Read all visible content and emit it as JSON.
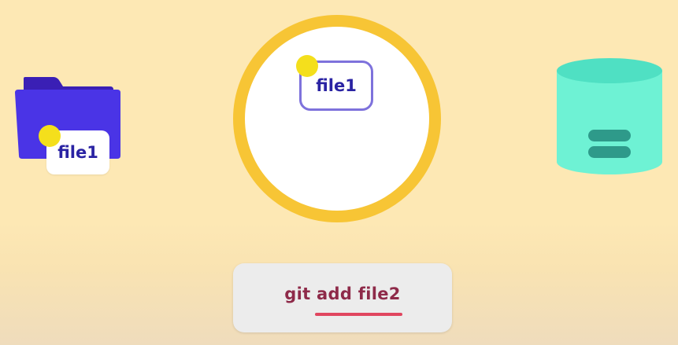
{
  "working_directory": {
    "icon": "folder-icon",
    "file_label": "file1",
    "colors": {
      "folder_back": "#3a1fb5",
      "folder_front": "#4a34e6",
      "file_text": "#2a23a3",
      "marker": "#f4df1c"
    }
  },
  "staging_area": {
    "file_label": "file1",
    "colors": {
      "ring": "#f7c535",
      "file_border": "#7e72dc"
    }
  },
  "repository": {
    "icon": "database-icon",
    "colors": {
      "cylinder": "#6ef2d4",
      "cylinder_top": "#4fe0c3",
      "bars": "#2e9a8a"
    }
  },
  "command": {
    "text": "git add file2",
    "colors": {
      "text": "#8e2a49",
      "underline": "#e0465f"
    }
  }
}
